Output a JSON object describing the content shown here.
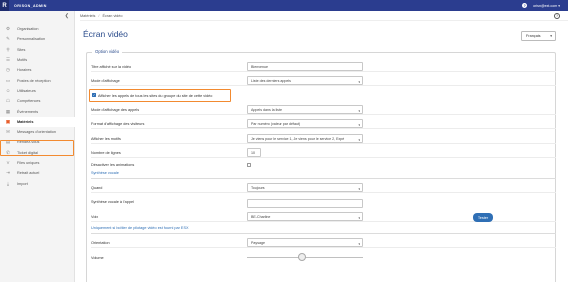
{
  "topbar": {
    "logo_letter": "R",
    "brand": "ORISON_ADMIN",
    "user_label": "orisn@ext.com ▾",
    "help": "?"
  },
  "sidebar": {
    "collapse": "❮",
    "items": [
      {
        "icon": "gear-icon",
        "glyph": "⚙",
        "label": "Organisation"
      },
      {
        "icon": "brush-icon",
        "glyph": "✎",
        "label": "Personnalisation"
      },
      {
        "icon": "pin-icon",
        "glyph": "⚲",
        "label": "Sites"
      },
      {
        "icon": "list-icon",
        "glyph": "☰",
        "label": "Motifs"
      },
      {
        "icon": "clock-icon",
        "glyph": "◷",
        "label": "Horaires"
      },
      {
        "icon": "desk-icon",
        "glyph": "▭",
        "label": "Postes de réception"
      },
      {
        "icon": "users-icon",
        "glyph": "☺",
        "label": "Utilisateurs"
      },
      {
        "icon": "badge-icon",
        "glyph": "☖",
        "label": "Compétences"
      },
      {
        "icon": "calendar-icon",
        "glyph": "▦",
        "label": "Événements"
      },
      {
        "icon": "monitor-icon",
        "glyph": "▣",
        "label": "Matériels"
      },
      {
        "icon": "chat-icon",
        "glyph": "✉",
        "label": "Messages d'orientation"
      },
      {
        "icon": "calendar-check-icon",
        "glyph": "▤",
        "label": "Rendez-vous"
      },
      {
        "icon": "phone-icon",
        "glyph": "✆",
        "label": "Ticket digital"
      },
      {
        "icon": "filter-icon",
        "glyph": "⋎",
        "label": "Files uniques"
      },
      {
        "icon": "exit-icon",
        "glyph": "⇥",
        "label": "Retrait actuel"
      },
      {
        "icon": "import-icon",
        "glyph": "⤓",
        "label": "Import"
      }
    ],
    "active_index": 9
  },
  "breadcrumb": {
    "items": [
      "Matériels",
      "Écran vidéo"
    ],
    "separator": "/",
    "help": "?"
  },
  "page": {
    "title": "Écran vidéo",
    "language": "Français"
  },
  "form": {
    "legend": "Option vidéo",
    "fields": {
      "title_label": "Titre affiché sur la vidéo",
      "title_value": "Bienvenue",
      "display_mode_label": "Mode d'affichage",
      "display_mode_value": "Liste des derniers appels",
      "show_all_label": "Afficher les appels de tous les sites du groupe du site de cette vidéo",
      "calls_mode_label": "Mode d'affichage des appels",
      "calls_mode_value": "Appels dans la liste",
      "visitor_format_label": "Format d'affichage des visiteurs",
      "visitor_format_value": "Par numéro (valeur par défaut)",
      "motives_label": "Afficher les motifs",
      "motives_value": "Je viens pour le service 1, Je viens pour le service 2, Expé",
      "lines_label": "Nombre de lignes",
      "lines_value": "10",
      "animations_label": "Désactiver les animations"
    },
    "speech": {
      "heading": "Synthèse vocale",
      "when_label": "Quand",
      "when_value": "Toujours",
      "call_label": "Synthèse vocale à l'appel",
      "call_value": "",
      "voice_label": "Voix",
      "voice_value": "BE-Charline",
      "test_button": "Tester"
    },
    "esx": {
      "heading": "Uniquement si boîtier de pilotage vidéo est fourni par ESX",
      "orientation_label": "Orientation",
      "orientation_value": "Paysage",
      "volume_label": "Volume",
      "volume_level": 0.47
    }
  }
}
